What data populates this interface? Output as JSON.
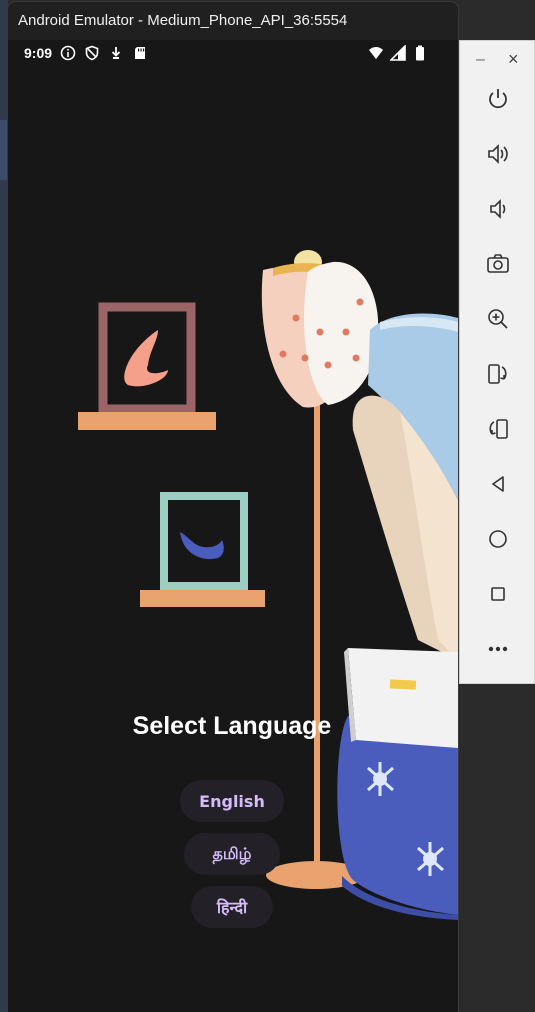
{
  "window": {
    "title": "Android Emulator - Medium_Phone_API_36:5554"
  },
  "status_bar": {
    "time": "9:09",
    "left_icons": [
      "info-icon",
      "shield-icon",
      "download-icon",
      "sd-card-icon"
    ],
    "right_icons": [
      "wifi-icon",
      "cellular-signal-icon",
      "battery-icon"
    ]
  },
  "screen": {
    "title": "Select Language",
    "languages": [
      {
        "label": "English"
      },
      {
        "label": "தமிழ்"
      },
      {
        "label": "हिन्दी"
      }
    ]
  },
  "toolbar": {
    "window_controls": [
      "minimize-icon",
      "close-icon"
    ],
    "buttons": [
      "power-icon",
      "volume-up-icon",
      "volume-down-icon",
      "camera-icon",
      "zoom-icon",
      "rotate-left-icon",
      "rotate-right-icon",
      "back-icon",
      "home-icon",
      "overview-icon",
      "more-icon"
    ]
  },
  "colors": {
    "screen_bg": "#171717",
    "button_bg": "#242028",
    "button_text": "#d3bcf8",
    "frame1": "#9b6467",
    "frame2": "#9ccfc4",
    "shelf": "#e9a26d",
    "lamp_pole": "#e9a26d",
    "blanket": "#4a5dbd",
    "sleeve": "#a9cbe8"
  }
}
